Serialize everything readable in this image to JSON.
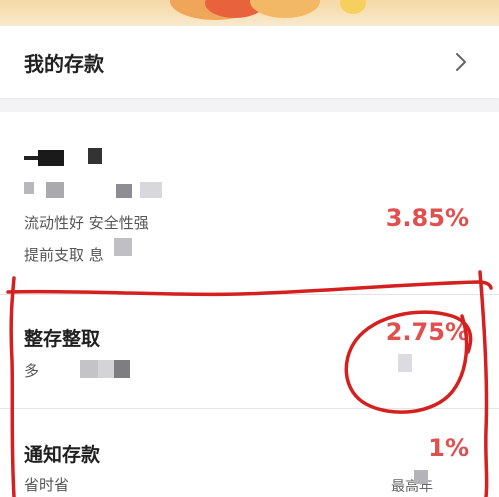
{
  "my_deposits": {
    "title": "我的存款"
  },
  "products": [
    {
      "name": "",
      "line1": "",
      "line2": "流动性好 安全性强",
      "line3": "提前支取 息",
      "rate": "3.85%"
    },
    {
      "name": "整存整取",
      "line1": "多",
      "rate": "2.75%"
    },
    {
      "name": "通知存款",
      "line1": "省时省",
      "rate": "1%",
      "rate_caption": "最高年"
    }
  ],
  "colors": {
    "accent_red": "#e0504f",
    "annotation_red": "#d4201f",
    "background": "#f3f3f5"
  },
  "icons": {
    "chevron": "chevron-right-icon"
  }
}
